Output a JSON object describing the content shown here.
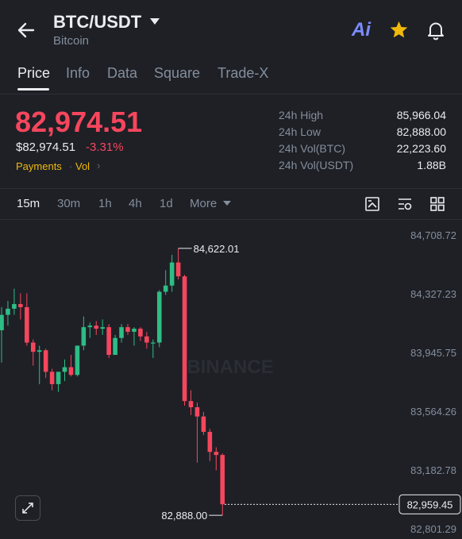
{
  "header": {
    "pair": "BTC/USDT",
    "name": "Bitcoin",
    "ai_label": "Ai",
    "icons": [
      "back-arrow-icon",
      "caret-down-icon",
      "star-icon",
      "bell-icon"
    ]
  },
  "tabs": [
    {
      "label": "Price",
      "active": true
    },
    {
      "label": "Info",
      "active": false
    },
    {
      "label": "Data",
      "active": false
    },
    {
      "label": "Square",
      "active": false
    },
    {
      "label": "Trade-X",
      "active": false
    }
  ],
  "price": {
    "last": "82,974.51",
    "usd": "$82,974.51",
    "change": "-3.31%",
    "tags": [
      "Payments",
      "Vol"
    ]
  },
  "stats": [
    {
      "label": "24h High",
      "value": "85,966.04"
    },
    {
      "label": "24h Low",
      "value": "82,888.00"
    },
    {
      "label": "24h Vol(BTC)",
      "value": "22,223.60"
    },
    {
      "label": "24h Vol(USDT)",
      "value": "1.88B"
    }
  ],
  "intervals": [
    {
      "label": "15m",
      "active": true
    },
    {
      "label": "30m",
      "active": false
    },
    {
      "label": "1h",
      "active": false
    },
    {
      "label": "4h",
      "active": false
    },
    {
      "label": "1d",
      "active": false
    },
    {
      "label": "More",
      "active": false
    }
  ],
  "colors": {
    "up": "#2ebd85",
    "down": "#f6465d",
    "accent": "#f0b90b",
    "background": "#1e2026"
  },
  "chart_data": {
    "type": "candlestick",
    "interval": "15m",
    "y_axis_ticks": [
      "84,708.72",
      "84,327.23",
      "83,945.75",
      "83,564.26",
      "83,182.78",
      "82,801.29"
    ],
    "ylim": [
      82801.29,
      84708.72
    ],
    "high_marker": "84,622.01",
    "low_marker": "82,888.00",
    "last_price_label": "82,959.45",
    "watermark": "BINANCE",
    "candles": [
      {
        "o": 84090,
        "h": 84240,
        "l": 83880,
        "c": 84190
      },
      {
        "o": 84190,
        "h": 84280,
        "l": 84120,
        "c": 84230
      },
      {
        "o": 84230,
        "h": 84360,
        "l": 84190,
        "c": 84260
      },
      {
        "o": 84260,
        "h": 84330,
        "l": 84160,
        "c": 84240
      },
      {
        "o": 84240,
        "h": 84330,
        "l": 83990,
        "c": 84010
      },
      {
        "o": 84010,
        "h": 84030,
        "l": 83860,
        "c": 83950
      },
      {
        "o": 83950,
        "h": 83990,
        "l": 83740,
        "c": 83960
      },
      {
        "o": 83960,
        "h": 83970,
        "l": 83780,
        "c": 83820
      },
      {
        "o": 83820,
        "h": 83840,
        "l": 83700,
        "c": 83740
      },
      {
        "o": 83740,
        "h": 83800,
        "l": 83690,
        "c": 83820
      },
      {
        "o": 83820,
        "h": 83900,
        "l": 83760,
        "c": 83850
      },
      {
        "o": 83850,
        "h": 83930,
        "l": 83790,
        "c": 83800
      },
      {
        "o": 83800,
        "h": 83990,
        "l": 83790,
        "c": 83990
      },
      {
        "o": 83990,
        "h": 84180,
        "l": 83960,
        "c": 84110
      },
      {
        "o": 84110,
        "h": 84140,
        "l": 84040,
        "c": 84120
      },
      {
        "o": 84120,
        "h": 84150,
        "l": 84060,
        "c": 84100
      },
      {
        "o": 84100,
        "h": 84160,
        "l": 84060,
        "c": 84110
      },
      {
        "o": 84110,
        "h": 84130,
        "l": 83910,
        "c": 83930
      },
      {
        "o": 83930,
        "h": 84060,
        "l": 83930,
        "c": 84040
      },
      {
        "o": 84040,
        "h": 84130,
        "l": 84010,
        "c": 84110
      },
      {
        "o": 84110,
        "h": 84130,
        "l": 84060,
        "c": 84080
      },
      {
        "o": 84080,
        "h": 84110,
        "l": 83990,
        "c": 84100
      },
      {
        "o": 84100,
        "h": 84110,
        "l": 84020,
        "c": 84050
      },
      {
        "o": 84050,
        "h": 84080,
        "l": 83970,
        "c": 84010
      },
      {
        "o": 84010,
        "h": 84030,
        "l": 83910,
        "c": 84010
      },
      {
        "o": 84010,
        "h": 84350,
        "l": 83980,
        "c": 84340
      },
      {
        "o": 84340,
        "h": 84480,
        "l": 84320,
        "c": 84380
      },
      {
        "o": 84380,
        "h": 84580,
        "l": 84340,
        "c": 84530
      },
      {
        "o": 84530,
        "h": 84622,
        "l": 84420,
        "c": 84440
      },
      {
        "o": 84440,
        "h": 84450,
        "l": 83600,
        "c": 83630
      },
      {
        "o": 83630,
        "h": 83700,
        "l": 83540,
        "c": 83590
      },
      {
        "o": 83590,
        "h": 83620,
        "l": 83230,
        "c": 83530
      },
      {
        "o": 83530,
        "h": 83560,
        "l": 83410,
        "c": 83430
      },
      {
        "o": 83430,
        "h": 83450,
        "l": 83240,
        "c": 83300
      },
      {
        "o": 83300,
        "h": 83330,
        "l": 83180,
        "c": 83280
      },
      {
        "o": 83280,
        "h": 83290,
        "l": 82888,
        "c": 82959.45
      }
    ]
  }
}
